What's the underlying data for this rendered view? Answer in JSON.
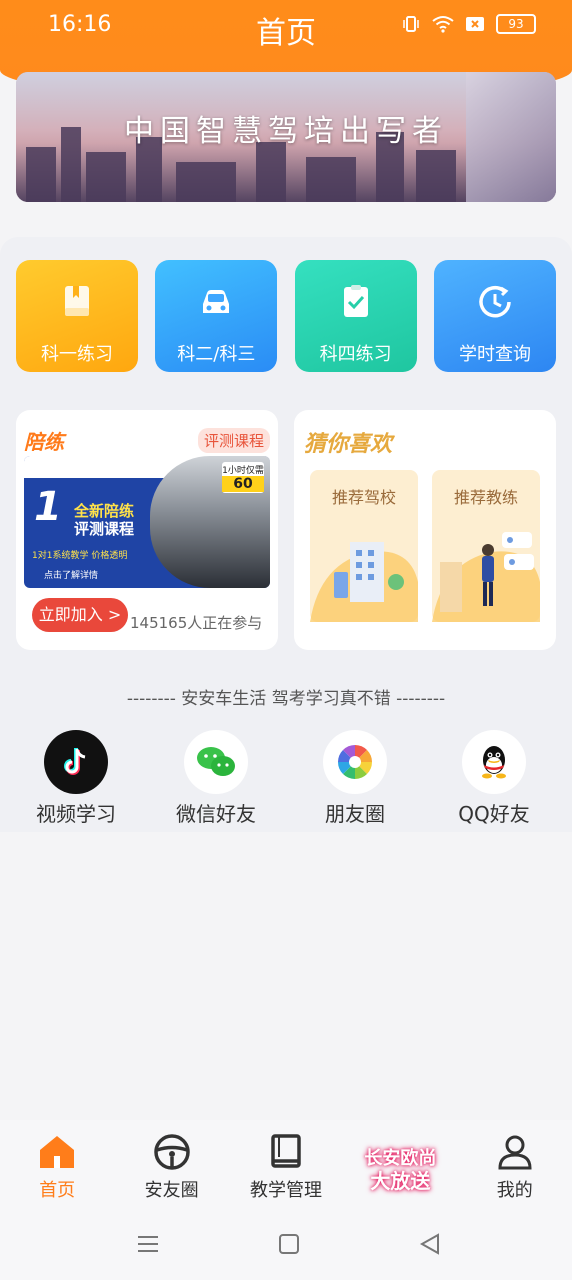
{
  "status_bar": {
    "time": "16:16",
    "battery": "93"
  },
  "header": {
    "title": "首页"
  },
  "banner": {
    "text": "中国智慧驾培出写者"
  },
  "subjects": [
    {
      "label": "科一练习",
      "icon": "book-icon"
    },
    {
      "label": "科二/科三",
      "icon": "car-icon"
    },
    {
      "label": "科四练习",
      "icon": "checklist-icon"
    },
    {
      "label": "学时查询",
      "icon": "clock-icon"
    }
  ],
  "practice_card": {
    "title": "陪练",
    "badge": "评测课程",
    "ad": {
      "big_num": "1",
      "line1": "全新陪练",
      "line2": "评测课程",
      "line3": "1对1系统教学 价格透明",
      "line4": "点击了解详情",
      "price_top": "1小时仅需",
      "price": "60"
    },
    "join_label": "立即加入 >",
    "participants": "145165人正在参与"
  },
  "guess_card": {
    "title": "猜你喜欢",
    "items": [
      {
        "label": "推荐驾校"
      },
      {
        "label": "推荐教练"
      }
    ]
  },
  "slogan": "--------  安安车生活  驾考学习真不错  --------",
  "share": [
    {
      "label": "视频学习",
      "icon": "tiktok-icon"
    },
    {
      "label": "微信好友",
      "icon": "wechat-icon"
    },
    {
      "label": "朋友圈",
      "icon": "moments-icon"
    },
    {
      "label": "QQ好友",
      "icon": "qq-icon"
    }
  ],
  "bottom_nav": [
    {
      "label": "首页",
      "icon": "home-icon",
      "active": true
    },
    {
      "label": "安友圈",
      "icon": "steering-wheel-icon"
    },
    {
      "label": "教学管理",
      "icon": "book-icon"
    },
    {
      "label": "长安欧尚大放送",
      "icon": "promo-icon"
    },
    {
      "label": "我的",
      "icon": "user-icon"
    }
  ],
  "promo": {
    "line1": "长安欧尚",
    "line2": "大放送"
  },
  "colors": {
    "accent": "#ff8c1a",
    "active_nav": "#ff7d1a",
    "join_button": "#e9483b"
  }
}
